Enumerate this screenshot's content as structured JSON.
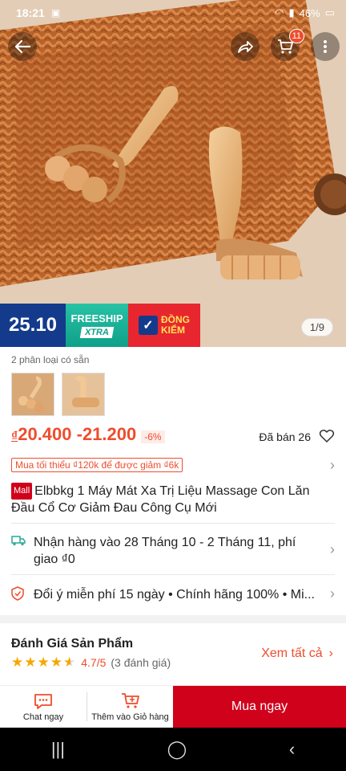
{
  "status_bar": {
    "time": "18:21",
    "battery": "46%"
  },
  "top_nav": {
    "cart_count": "11"
  },
  "promo": {
    "date_badge": "25.10",
    "freeship_line1": "FREESHIP",
    "freeship_line2": "XTRA",
    "inspect_line1": "ĐỒNG",
    "inspect_line2": "KIỂM"
  },
  "image_counter": "1/9",
  "variants": {
    "label": "2 phân loại có sẵn",
    "count": 2
  },
  "price": {
    "currency": "₫",
    "range_mid": "20.400 - ",
    "range_end": "21.200",
    "discount": "-6%",
    "sold": "Đã bán 26"
  },
  "min_order": "Mua tối thiểu ₫120k để được giảm ₫6k",
  "product": {
    "mall_tag": "Mall",
    "title": "Elbbkg 1 Máy Mát Xa Trị Liệu Massage Con Lăn Đầu Cổ Cơ Giảm Đau Công Cụ Mới"
  },
  "shipping": {
    "text": "Nhận hàng vào 28 Tháng 10 - 2 Tháng 11, phí giao ₫0"
  },
  "guarantee": {
    "text": "Đổi ý miễn phí 15 ngày  •  Chính hãng 100%  •  Mi..."
  },
  "reviews": {
    "title": "Đánh Giá Sản Phẩm",
    "score": "4.7/5",
    "count": "(3 đánh giá)",
    "see_all": "Xem tất cả",
    "stars_value": 4.7
  },
  "bottom_bar": {
    "chat_label": "Chat ngay",
    "add_cart_label": "Thêm vào Giỏ hàng",
    "buy_label": "Mua ngay"
  },
  "colors": {
    "accent": "#ee4d2d",
    "buy": "#d0011b"
  }
}
